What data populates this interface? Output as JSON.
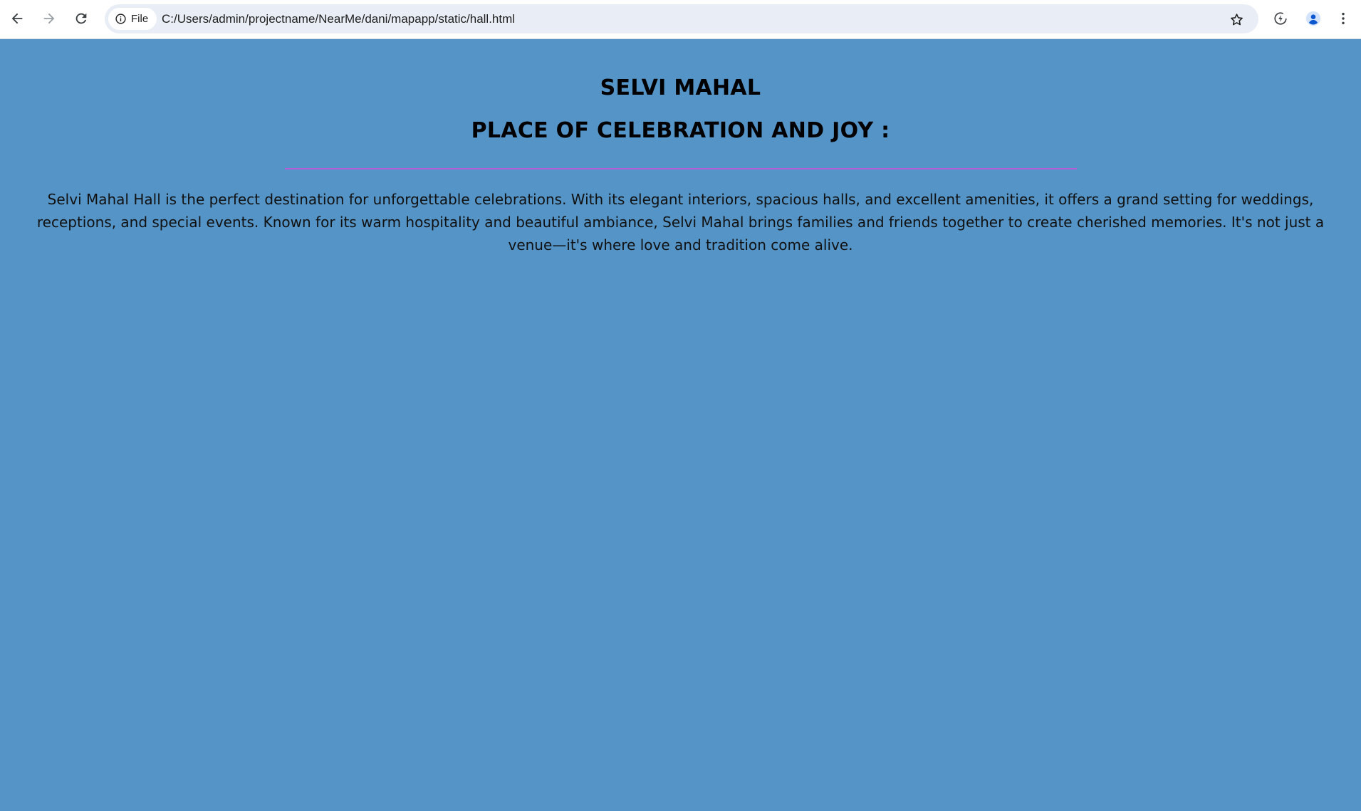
{
  "browser": {
    "site_chip_label": "File",
    "url": "C:/Users/admin/projectname/NearMe/dani/mapapp/static/hall.html",
    "icons": {
      "back": "arrow-left-icon",
      "forward": "arrow-right-icon",
      "reload": "reload-icon",
      "site_info": "info-icon",
      "bookmark": "star-icon",
      "performance": "performance-icon",
      "profile": "profile-avatar-icon",
      "menu": "kebab-menu-icon"
    }
  },
  "page": {
    "background_color": "#5594c7",
    "divider_color": "#b55ed6",
    "title": "SELVI MAHAL",
    "subtitle": "PLACE OF CELEBRATION AND JOY :",
    "description": "Selvi Mahal Hall is the perfect destination for unforgettable celebrations. With its elegant interiors, spacious halls, and excellent amenities, it offers a grand setting for weddings, receptions, and special events. Known for its warm hospitality and beautiful ambiance, Selvi Mahal brings families and friends together to create cherished memories. It's not just a venue—it's where love and tradition come alive."
  }
}
